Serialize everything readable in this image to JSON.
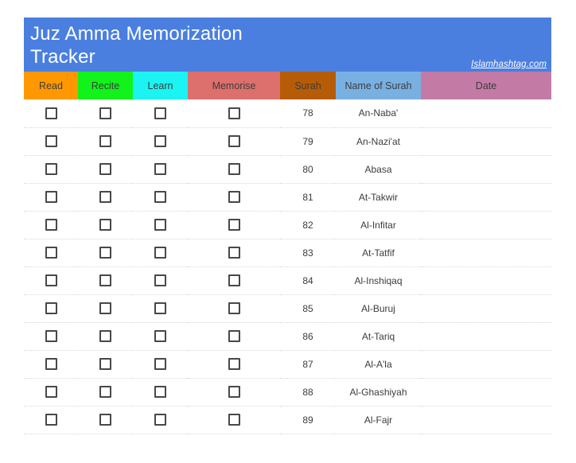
{
  "header": {
    "title": "Juz Amma Memorization Tracker",
    "watermark": "Islamhashtag.com",
    "banner_color": "#4a7fe0"
  },
  "table": {
    "columns": [
      {
        "label": "Read",
        "key": "read",
        "type": "checkbox",
        "color": "#ff9800"
      },
      {
        "label": "Recite",
        "key": "recite",
        "type": "checkbox",
        "color": "#12f31b"
      },
      {
        "label": "Learn",
        "key": "learn",
        "type": "checkbox",
        "color": "#1cf3f3"
      },
      {
        "label": "Memorise",
        "key": "memorise",
        "type": "checkbox",
        "color": "#dd6f6c"
      },
      {
        "label": "Surah",
        "key": "surah",
        "type": "text",
        "color": "#b65c06"
      },
      {
        "label": "Name of Surah",
        "key": "name",
        "type": "text",
        "color": "#79b0e2"
      },
      {
        "label": "Date",
        "key": "date",
        "type": "text",
        "color": "#c37ba6"
      }
    ],
    "rows": [
      {
        "surah": "78",
        "name": "An-Naba'",
        "date": ""
      },
      {
        "surah": "79",
        "name": "An-Nazi'at",
        "date": ""
      },
      {
        "surah": "80",
        "name": "Abasa",
        "date": ""
      },
      {
        "surah": "81",
        "name": "At-Takwir",
        "date": ""
      },
      {
        "surah": "82",
        "name": "Al-Infitar",
        "date": ""
      },
      {
        "surah": "83",
        "name": "At-Tatfif",
        "date": ""
      },
      {
        "surah": "84",
        "name": "Al-Inshiqaq",
        "date": ""
      },
      {
        "surah": "85",
        "name": "Al-Buruj",
        "date": ""
      },
      {
        "surah": "86",
        "name": "At-Tariq",
        "date": ""
      },
      {
        "surah": "87",
        "name": "Al-A'la",
        "date": ""
      },
      {
        "surah": "88",
        "name": "Al-Ghashiyah",
        "date": ""
      },
      {
        "surah": "89",
        "name": "Al-Fajr",
        "date": ""
      }
    ]
  }
}
